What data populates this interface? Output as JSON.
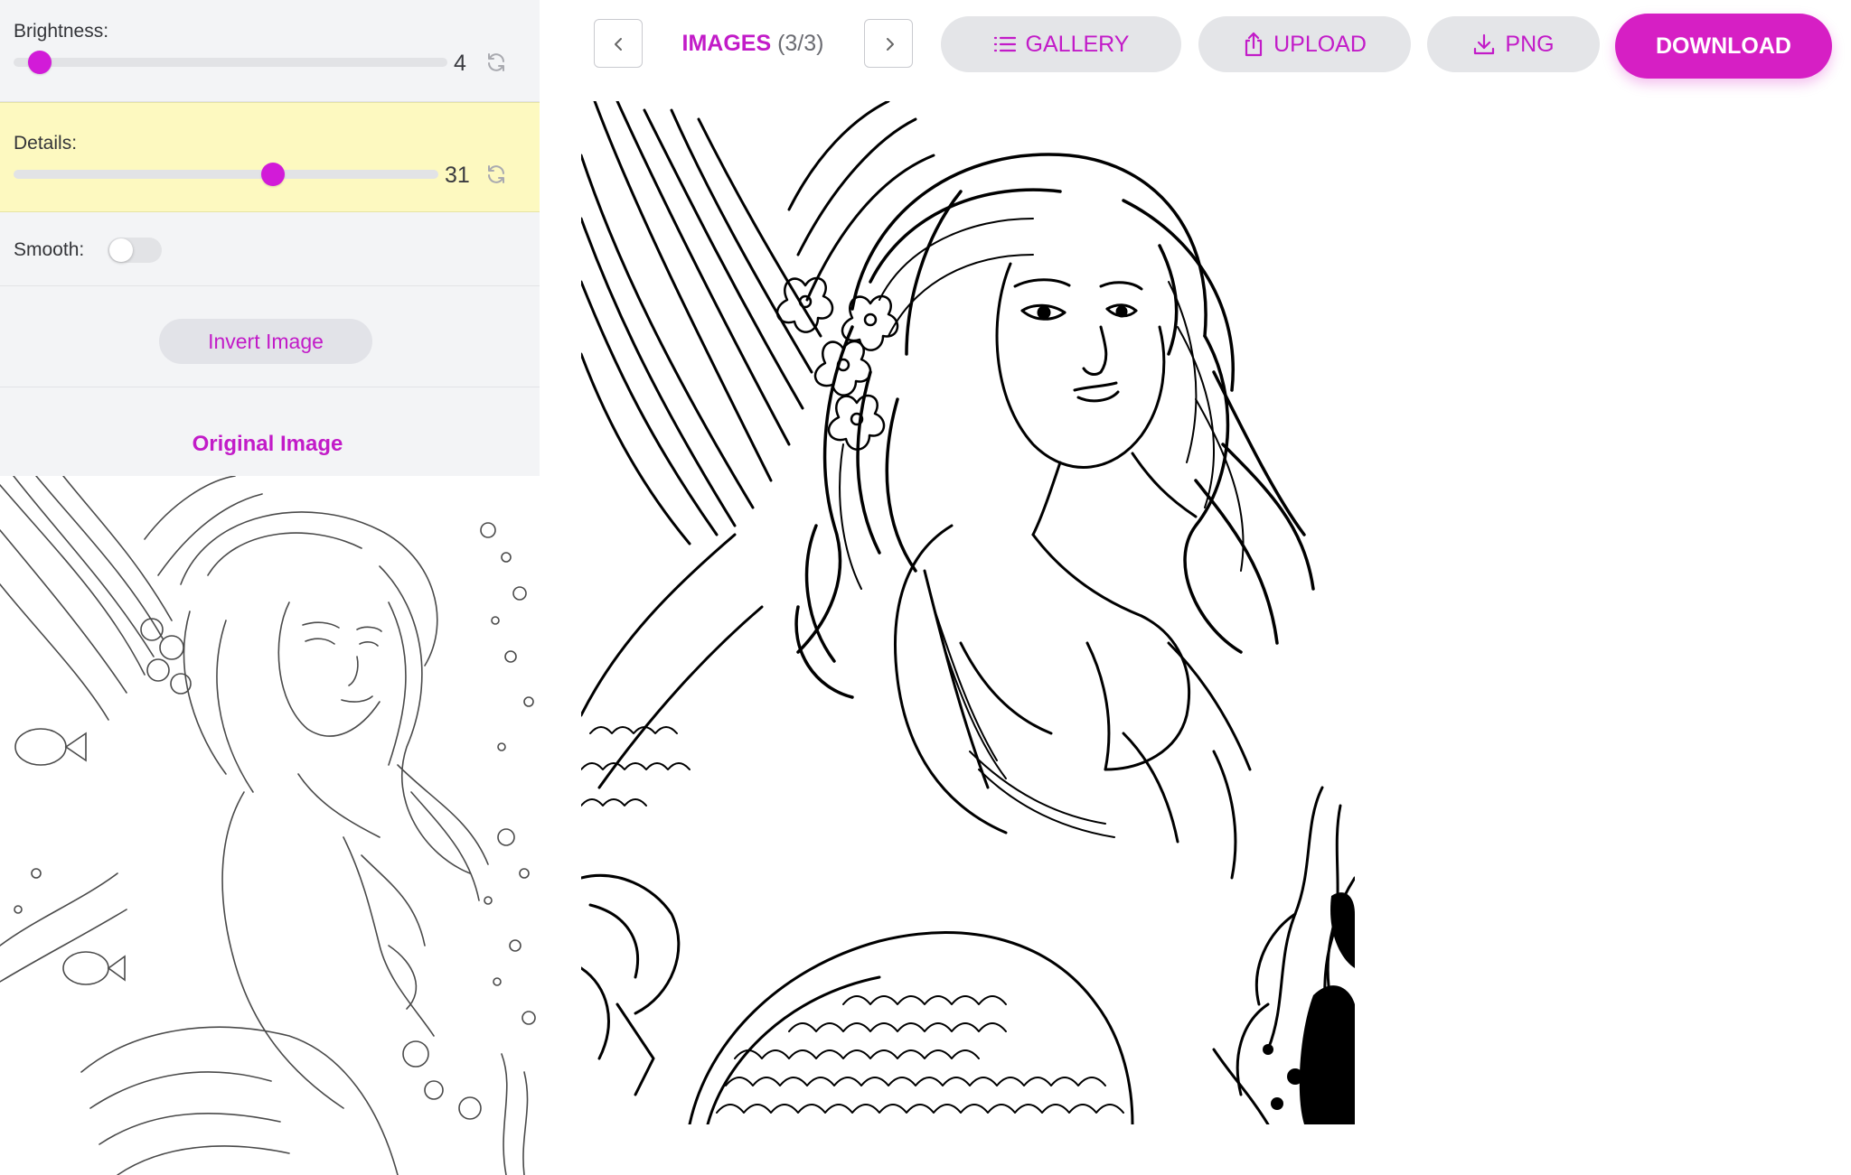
{
  "sidebar": {
    "brightness": {
      "label": "Brightness:",
      "value": "4",
      "level_percent": 6
    },
    "details": {
      "label": "Details:",
      "value": "31",
      "level_percent": 61
    },
    "smooth": {
      "label": "Smooth:",
      "enabled": false
    },
    "invert_button": "Invert Image",
    "original_title": "Original Image"
  },
  "toolbar": {
    "images_title": "IMAGES",
    "images_count": "(3/3)",
    "gallery": "GALLERY",
    "upload": "UPLOAD",
    "png": "PNG",
    "download": "DOWNLOAD"
  },
  "colors": {
    "accent": "#c21bc8",
    "download_bg": "#d61fc4",
    "details_highlight": "#fdf9c0",
    "panel_bg": "#f3f4f6"
  },
  "icons": {
    "prev": "chevron-left-icon",
    "next": "chevron-right-icon",
    "gallery": "list-icon",
    "upload": "share-upload-icon",
    "png": "download-tray-icon",
    "reset": "refresh-icon"
  }
}
